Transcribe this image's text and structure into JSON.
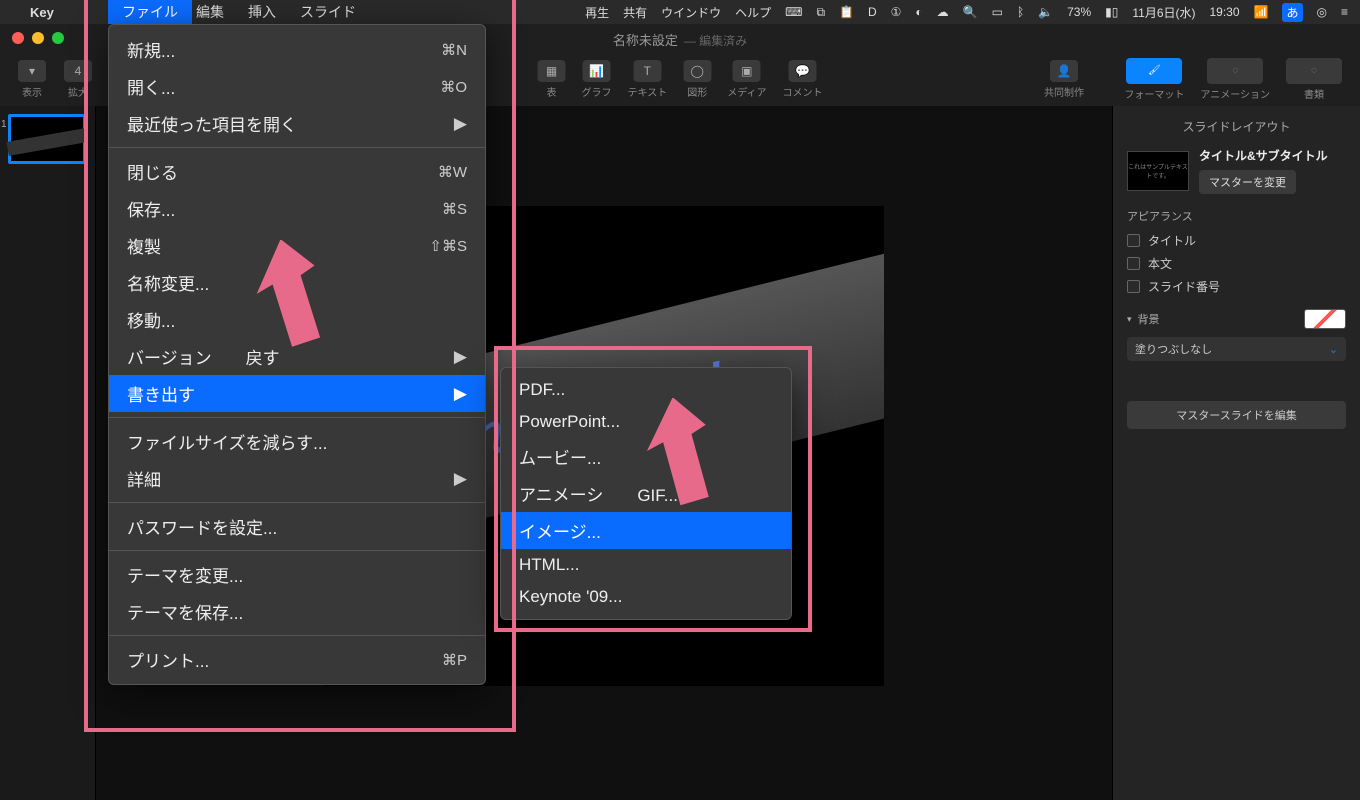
{
  "menubar": {
    "app": "Key",
    "items": [
      "ファイル",
      "編集",
      "挿入",
      "スライド"
    ],
    "right_partial": [
      "再生",
      "共有",
      "ウインドウ",
      "ヘルプ"
    ],
    "battery": "73%",
    "date": "11月6日(水)",
    "time": "19:30",
    "ime": "あ"
  },
  "window": {
    "title": "名称未設定",
    "subtitle": "— 編集済み"
  },
  "toolbar": {
    "left": [
      {
        "icon": "▾",
        "label": "表示"
      },
      {
        "icon": "4",
        "label": "拡大"
      }
    ],
    "center": [
      {
        "icon": "▦",
        "label": "表"
      },
      {
        "icon": "📊",
        "label": "グラフ"
      },
      {
        "icon": "T",
        "label": "テキスト"
      },
      {
        "icon": "◯",
        "label": "図形"
      },
      {
        "icon": "▣",
        "label": "メディア"
      },
      {
        "icon": "💬",
        "label": "コメント"
      }
    ],
    "collab": {
      "icon": "👤",
      "label": "共同制作"
    },
    "right": [
      {
        "label": "フォーマット",
        "active": true
      },
      {
        "label": "アニメーション",
        "active": false
      },
      {
        "label": "書類",
        "active": false
      }
    ]
  },
  "slide_text": "れてみよう！",
  "inspector": {
    "header": "スライドレイアウト",
    "layout_thumb_text": "これはサンプルテキストです。",
    "layout_title": "タイトル&サブタイトル",
    "change_master": "マスターを変更",
    "appearance_label": "アピアランス",
    "checks": [
      "タイトル",
      "本文",
      "スライド番号"
    ],
    "background_label": "背景",
    "fill_select": "塗りつぶしなし",
    "edit_master": "マスタースライドを編集"
  },
  "file_menu": [
    {
      "label": "新規...",
      "shortcut": "⌘N"
    },
    {
      "label": "開く...",
      "shortcut": "⌘O"
    },
    {
      "label": "最近使った項目を開く",
      "submenu": true
    },
    {
      "sep": true
    },
    {
      "label": "閉じる",
      "shortcut": "⌘W"
    },
    {
      "label": "保存...",
      "shortcut": "⌘S"
    },
    {
      "label": "複製",
      "shortcut": "⇧⌘S"
    },
    {
      "label": "名称変更..."
    },
    {
      "label": "移動..."
    },
    {
      "label": "バージョン　　戻す",
      "submenu": true
    },
    {
      "label": "書き出す",
      "submenu": true,
      "highlighted": true
    },
    {
      "sep": true
    },
    {
      "label": "ファイルサイズを減らす..."
    },
    {
      "label": "詳細",
      "submenu": true
    },
    {
      "sep": true
    },
    {
      "label": "パスワードを設定..."
    },
    {
      "sep": true
    },
    {
      "label": "テーマを変更..."
    },
    {
      "label": "テーマを保存..."
    },
    {
      "sep": true
    },
    {
      "label": "プリント...",
      "shortcut": "⌘P"
    }
  ],
  "export_submenu": [
    {
      "label": "PDF..."
    },
    {
      "label": "PowerPoint..."
    },
    {
      "label": "ムービー..."
    },
    {
      "label": "アニメーシ　　GIF..."
    },
    {
      "label": "イメージ...",
      "highlighted": true
    },
    {
      "label": "HTML..."
    },
    {
      "label": "Keynote '09..."
    }
  ]
}
